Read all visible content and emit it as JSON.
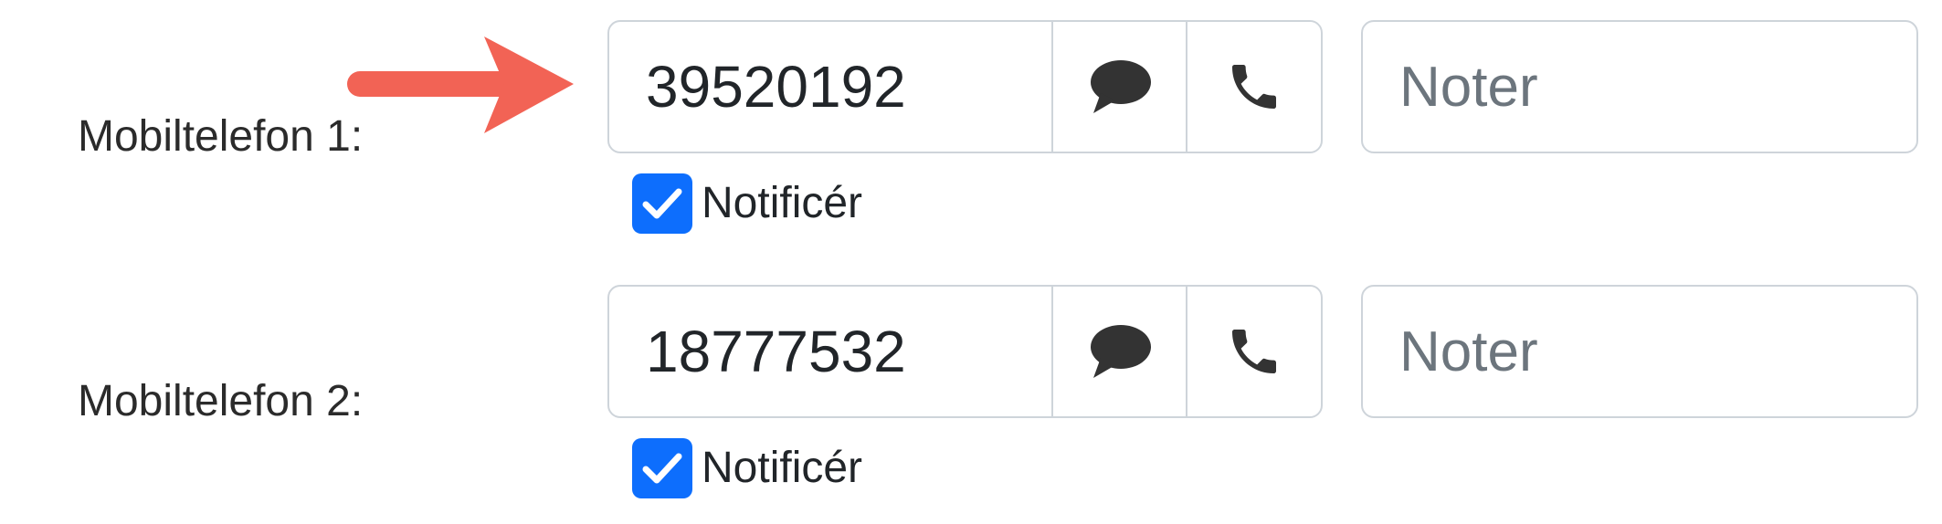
{
  "form": {
    "rows": [
      {
        "label": "Mobiltelefon 1:",
        "phone_value": "39520192",
        "note_placeholder": "Noter",
        "notify_label": "Notificér",
        "notify_checked": true
      },
      {
        "label": "Mobiltelefon 2:",
        "phone_value": "18777532",
        "note_placeholder": "Noter",
        "notify_label": "Notificér",
        "notify_checked": true
      }
    ]
  },
  "icons": {
    "sms": "speech-bubble-icon",
    "call": "phone-icon",
    "check": "checkmark-icon",
    "pointer": "arrow-right-icon"
  },
  "colors": {
    "accent": "#0d6efd",
    "arrow": "#f26355",
    "border": "#ced4da",
    "icon": "#333333",
    "placeholder": "#6c757d"
  }
}
